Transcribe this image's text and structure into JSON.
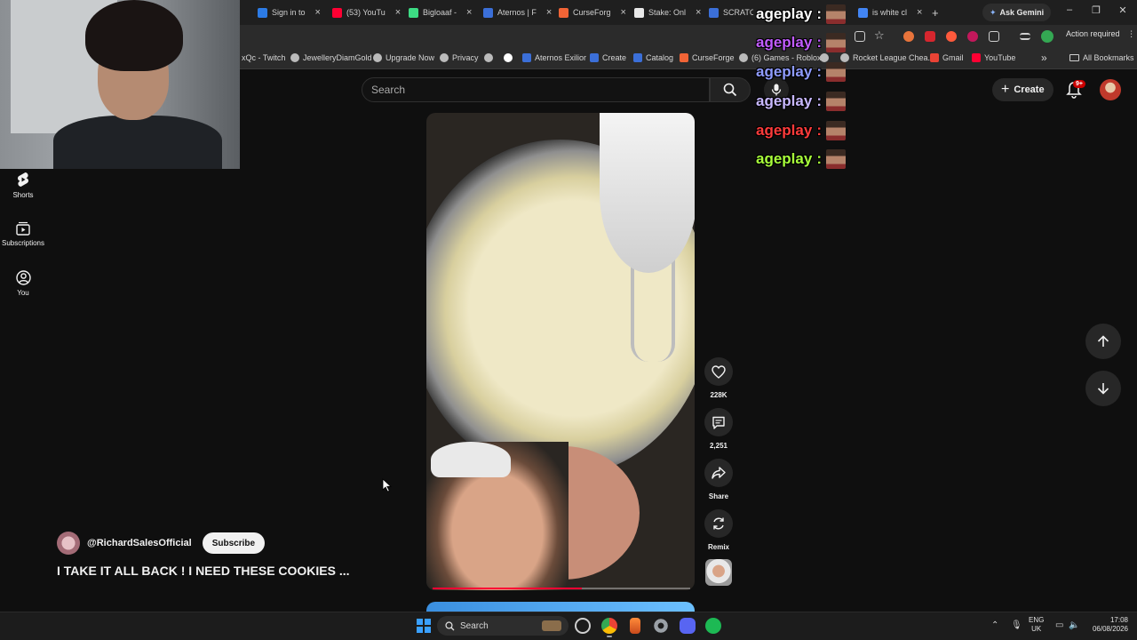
{
  "browser": {
    "tabs": [
      {
        "label": "Sign in to",
        "color": "#2c7be5"
      },
      {
        "label": "(53) YouTu",
        "color": "#ff0033"
      },
      {
        "label": "Bigloaaf -",
        "color": "#3ddc84"
      },
      {
        "label": "Aternos | F",
        "color": "#3b6fd8"
      },
      {
        "label": "CurseForg",
        "color": "#f16436"
      },
      {
        "label": "Stake: Onl",
        "color": "#e8e8e8"
      },
      {
        "label": "SCRATCH",
        "color": "#3b6fd8"
      },
      {
        "label": "is white cl",
        "color": "#4285f4"
      }
    ],
    "new_tab": "+",
    "ask_gemini": "Ask Gemini",
    "action_required": "Action required",
    "bookmarks": [
      {
        "label": "xQc - Twitch",
        "color": "#9146ff"
      },
      {
        "label": "JewelleryDiamGold",
        "color": "#bbbbbb"
      },
      {
        "label": "Upgrade Now",
        "color": "#bbbbbb"
      },
      {
        "label": "Privacy",
        "color": "#bbbbbb"
      },
      {
        "label": "",
        "color": "#bbbbbb"
      },
      {
        "label": "",
        "color": "#ffffff"
      },
      {
        "label": "Aternos Exilior",
        "color": "#3b6fd8"
      },
      {
        "label": "Create",
        "color": "#3b6fd8"
      },
      {
        "label": "Catalog",
        "color": "#3b6fd8"
      },
      {
        "label": "CurseForge",
        "color": "#f16436"
      },
      {
        "label": "(6) Games - Roblox",
        "color": "#bbbbbb"
      },
      {
        "label": "",
        "color": "#bbbbbb"
      },
      {
        "label": "Rocket League Chea...",
        "color": "#bbbbbb"
      },
      {
        "label": "Gmail",
        "color": "#ea4335"
      },
      {
        "label": "YouTube",
        "color": "#ff0033"
      }
    ],
    "bookmarks_more": "»",
    "all_bookmarks": "All Bookmarks"
  },
  "youtube": {
    "search_placeholder": "Search",
    "create_label": "Create",
    "notification_count": "9+",
    "nav": [
      {
        "label": "Shorts",
        "icon": "shorts-icon"
      },
      {
        "label": "Subscriptions",
        "icon": "subscriptions-icon"
      },
      {
        "label": "You",
        "icon": "you-icon"
      }
    ],
    "short": {
      "channel": "@RichardSalesOfficial",
      "subscribe_label": "Subscribe",
      "title": "I TAKE IT ALL BACK ! I NEED THESE COOKIES ...",
      "likes": "228K",
      "comments": "2,251",
      "share_label": "Share",
      "remix_label": "Remix",
      "progress": 0.58
    }
  },
  "chat_overlay": [
    {
      "user": "ageplay",
      "sep": ":",
      "color": "#ffffff"
    },
    {
      "user": "ageplay",
      "sep": ":",
      "color": "#c15cff"
    },
    {
      "user": "ageplay",
      "sep": ":",
      "color": "#8f9bff"
    },
    {
      "user": "ageplay",
      "sep": ":",
      "color": "#c8b8ff"
    },
    {
      "user": "ageplay",
      "sep": ":",
      "color": "#ff3b3b"
    },
    {
      "user": "ageplay",
      "sep": ":",
      "color": "#a8ff3b"
    }
  ],
  "taskbar": {
    "search_label": "Search",
    "lang_line1": "ENG",
    "lang_line2": "UK",
    "time": "17:08",
    "date": "06/08/2026"
  }
}
